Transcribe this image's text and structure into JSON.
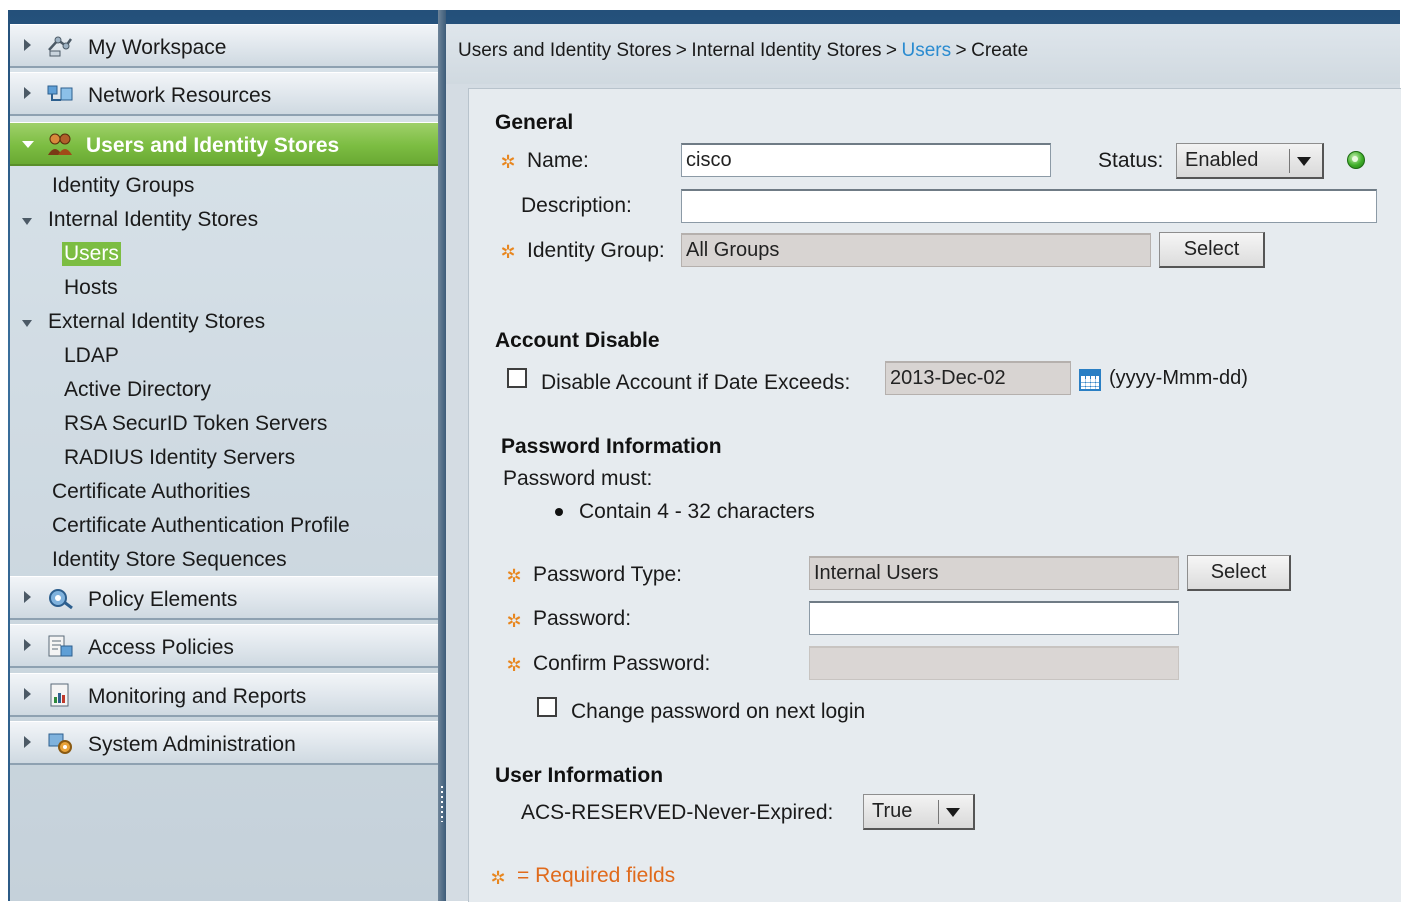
{
  "sidebar": {
    "drawers": [
      {
        "label": "My Workspace",
        "icon": "workspace-icon"
      },
      {
        "label": "Network Resources",
        "icon": "network-icon"
      },
      {
        "label": "Users and Identity Stores",
        "icon": "users-icon"
      },
      {
        "label": "Policy Elements",
        "icon": "policy-elements-icon"
      },
      {
        "label": "Access Policies",
        "icon": "access-policies-icon"
      },
      {
        "label": "Monitoring and Reports",
        "icon": "reports-icon"
      },
      {
        "label": "System Administration",
        "icon": "system-admin-icon"
      }
    ],
    "tree": [
      "Identity Groups",
      "Internal Identity Stores",
      "Users",
      "Hosts",
      "External Identity Stores",
      "LDAP",
      "Active Directory",
      "RSA SecurID Token Servers",
      "RADIUS Identity Servers",
      "Certificate Authorities",
      "Certificate Authentication Profile",
      "Identity Store Sequences"
    ],
    "selected": "Users",
    "active_color": "#7cbd42"
  },
  "breadcrumb": {
    "part1": "Users and Identity Stores",
    "part2": "Internal Identity Stores",
    "part3": "Users",
    "part4": "Create",
    "separator": ">",
    "link_color": "#2a8bd0"
  },
  "general": {
    "heading": "General",
    "name_label": "Name:",
    "name_value": "cisco",
    "status_label": "Status:",
    "status_value": "Enabled",
    "description_label": "Description:",
    "description_value": "",
    "identity_group_label": "Identity Group:",
    "identity_group_value": "All Groups",
    "select_label": "Select"
  },
  "account_disable": {
    "heading": "Account Disable",
    "checkbox_label": "Disable Account if Date Exceeds:",
    "checked": false,
    "date_value": "2013-Dec-02",
    "date_format": "(yyyy-Mmm-dd)"
  },
  "password": {
    "heading": "Password Information",
    "must_label": "Password must:",
    "rule": "Contain 4 - 32 characters",
    "type_label": "Password Type:",
    "type_value": "Internal Users",
    "select_label": "Select",
    "password_label": "Password:",
    "confirm_label": "Confirm Password:",
    "change_label": "Change password on next login",
    "change_checked": false
  },
  "user_info": {
    "heading": "User Information",
    "attr_label": "ACS-RESERVED-Never-Expired:",
    "attr_value": "True"
  },
  "footer": {
    "required_note": "= Required fields",
    "required_color": "#e06a1b"
  }
}
